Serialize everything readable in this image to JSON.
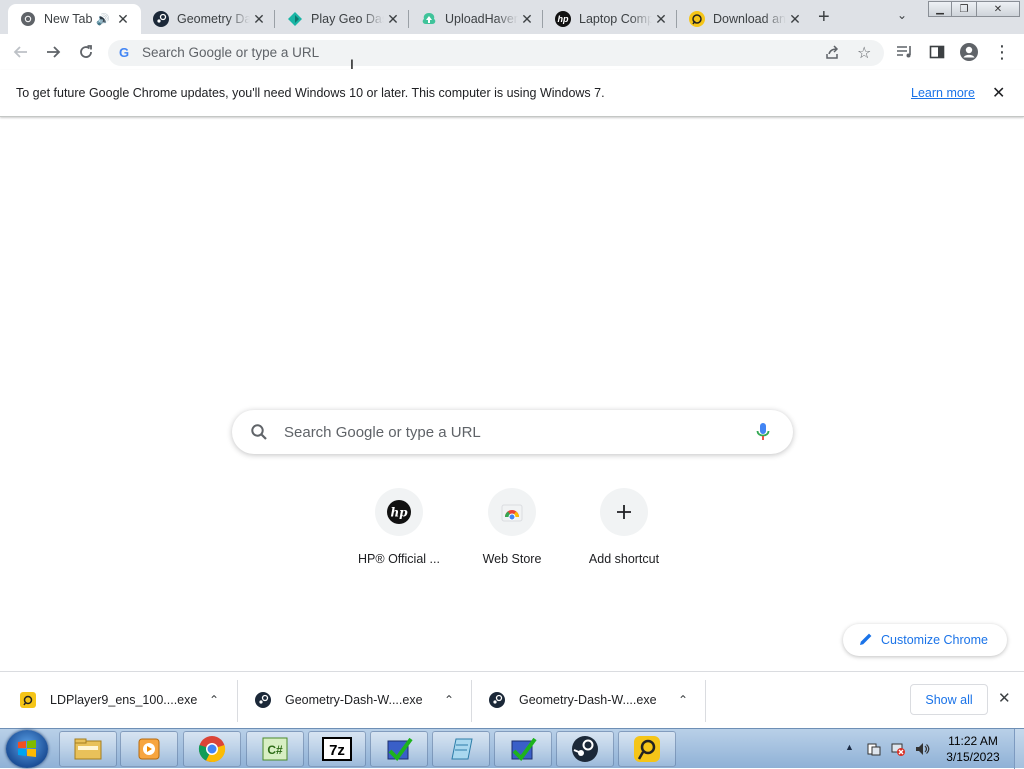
{
  "tabs": [
    {
      "title": "New Tab",
      "active": true,
      "icon": "chrome-icon"
    },
    {
      "title": "Geometry Dash",
      "icon": "steam-icon"
    },
    {
      "title": "Play Geo Dash",
      "icon": "geo-dash-icon"
    },
    {
      "title": "UploadHaven",
      "icon": "uploadhaven-icon"
    },
    {
      "title": "Laptop Computers",
      "icon": "hp-icon"
    },
    {
      "title": "Download and",
      "icon": "ldplayer-icon"
    }
  ],
  "omnibox": {
    "placeholder": "Search Google or type a URL"
  },
  "infobar": {
    "message": "To get future Google Chrome updates, you'll need Windows 10 or later. This computer is using Windows 7.",
    "learn_more": "Learn more"
  },
  "ntp": {
    "search_placeholder": "Search Google or type a URL",
    "shortcuts": [
      {
        "label": "HP® Official ...",
        "icon": "hp-icon"
      },
      {
        "label": "Web Store",
        "icon": "web-store-icon"
      },
      {
        "label": "Add shortcut",
        "icon": "plus-icon"
      }
    ],
    "customize_label": "Customize Chrome"
  },
  "downloads": {
    "items": [
      {
        "name": "LDPlayer9_ens_100....exe",
        "icon": "ldplayer-icon"
      },
      {
        "name": "Geometry-Dash-W....exe",
        "icon": "steam-icon"
      },
      {
        "name": "Geometry-Dash-W....exe",
        "icon": "steam-icon"
      }
    ],
    "show_all": "Show all"
  },
  "taskbar": {
    "apps": [
      "explorer-icon",
      "media-player-icon",
      "chrome-icon",
      "csharp-icon",
      "7zip-icon",
      "installer-icon",
      "notepad-icon",
      "installer-icon",
      "steam-icon",
      "ldplayer-icon"
    ],
    "time": "11:22 AM",
    "date": "3/15/2023"
  }
}
